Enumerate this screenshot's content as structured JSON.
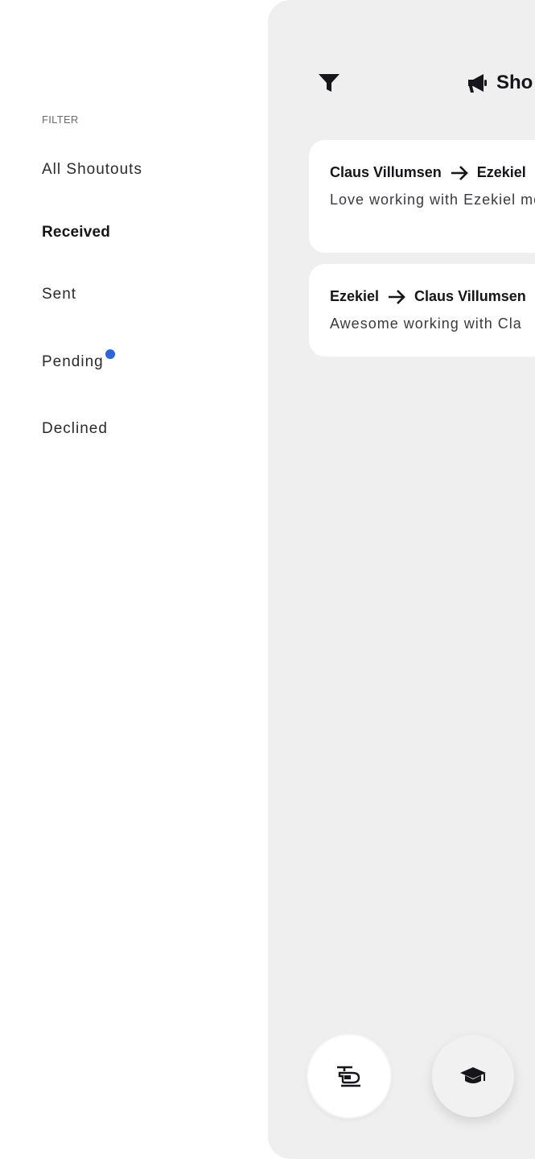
{
  "drawer": {
    "heading": "FILTER",
    "items": [
      {
        "label": "All Shoutouts",
        "active": false
      },
      {
        "label": "Received",
        "active": true
      },
      {
        "label": "Sent",
        "active": false
      },
      {
        "label": "Pending",
        "active": false,
        "has_badge": true
      },
      {
        "label": "Declined",
        "active": false
      }
    ]
  },
  "topbar": {
    "filter_icon": "filter-icon",
    "title_icon": "megaphone-icon",
    "title": "Sho"
  },
  "cards": [
    {
      "from": "Claus Villumsen",
      "to": "Ezekiel",
      "message": "Love working with Ezekiel mode."
    },
    {
      "from": "Ezekiel",
      "to": "Claus Villumsen",
      "message": "Awesome working with Cla"
    }
  ],
  "fabs": [
    {
      "icon": "helicopter-icon"
    },
    {
      "icon": "graduation-cap-icon"
    }
  ],
  "colors": {
    "accent": "#2a63e3",
    "panel_bg": "#efefef",
    "text": "#15151a"
  }
}
